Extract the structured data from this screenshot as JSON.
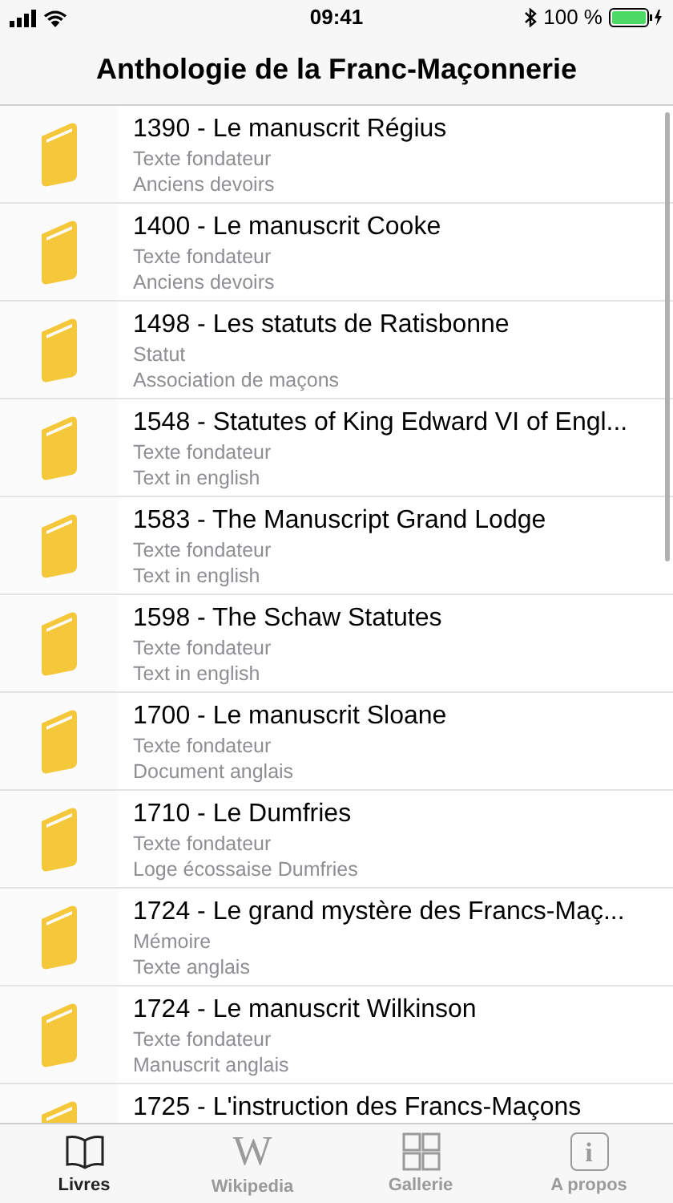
{
  "status_bar": {
    "time": "09:41",
    "battery": "100 %"
  },
  "nav": {
    "title": "Anthologie de la Franc-Maçonnerie"
  },
  "books": [
    {
      "title": "1390 - Le manuscrit Régius",
      "category": "Texte fondateur",
      "note": "Anciens devoirs"
    },
    {
      "title": "1400 - Le manuscrit Cooke",
      "category": "Texte fondateur",
      "note": "Anciens devoirs"
    },
    {
      "title": "1498 - Les statuts de Ratisbonne",
      "category": "Statut",
      "note": "Association de maçons"
    },
    {
      "title": "1548 - Statutes of King Edward VI of Engl...",
      "category": "Texte fondateur",
      "note": "Text in english"
    },
    {
      "title": "1583 - The Manuscript Grand Lodge",
      "category": "Texte fondateur",
      "note": "Text in english"
    },
    {
      "title": "1598 - The Schaw Statutes",
      "category": "Texte fondateur",
      "note": "Text in english"
    },
    {
      "title": "1700 - Le manuscrit Sloane",
      "category": "Texte fondateur",
      "note": "Document anglais"
    },
    {
      "title": "1710 - Le Dumfries",
      "category": "Texte fondateur",
      "note": "Loge écossaise Dumfries"
    },
    {
      "title": "1724 - Le grand mystère des Francs-Maç...",
      "category": "Mémoire",
      "note": "Texte anglais"
    },
    {
      "title": "1724 - Le manuscrit Wilkinson",
      "category": "Texte fondateur",
      "note": "Manuscrit anglais"
    },
    {
      "title": "1725 - L'instruction des Francs-Maçons"
    }
  ],
  "tabs": [
    {
      "label": "Livres",
      "kind": "book",
      "selected": true
    },
    {
      "label": "Wikipedia",
      "kind": "glyph",
      "glyph": "W",
      "selected": false
    },
    {
      "label": "Gallerie",
      "kind": "grid",
      "selected": false
    },
    {
      "label": "A propos",
      "kind": "boxed",
      "glyph": "i",
      "selected": false
    }
  ]
}
